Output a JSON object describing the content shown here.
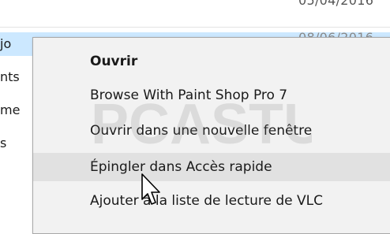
{
  "background": {
    "dates": [
      "05/04/2016",
      "08/06/2016"
    ],
    "file_names": [
      "jo",
      "nts",
      "me",
      "s"
    ]
  },
  "context_menu": {
    "items": [
      {
        "label": "Ouvrir",
        "bold": true
      },
      {
        "label": "Browse With Paint Shop Pro 7"
      },
      {
        "label": "Ouvrir dans une nouvelle fenêtre"
      },
      {
        "label": "Épingler dans Accès rapide",
        "hovered": true
      },
      {
        "label": "Ajouter à la liste de lecture de VLC"
      }
    ],
    "hover_color": "#e1e1e1",
    "background_color": "#f2f2f2"
  },
  "watermark": {
    "logo_text": "PCASTUCES"
  },
  "colors": {
    "selection": "#cce8ff",
    "border": "#a8a8a8"
  },
  "icons": {
    "cursor": "arrow-pointer-icon"
  }
}
